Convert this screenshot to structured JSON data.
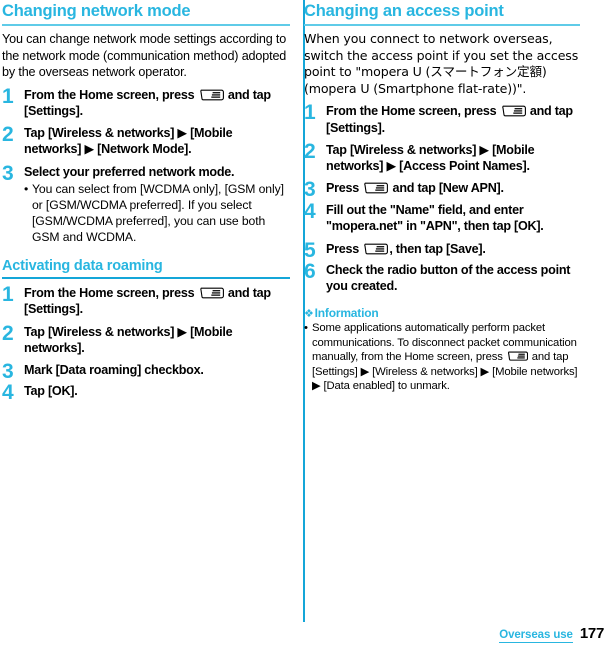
{
  "colors": {
    "accent": "#29b6e0",
    "accent_dark": "#14a6d8",
    "rule": "#5fcbe8",
    "text": "#000000"
  },
  "left_column": {
    "heading": "Changing network mode",
    "lead": "You can change network mode settings according to the network mode (communication method) adopted by the overseas network operator.",
    "steps": [
      {
        "number": "1",
        "text_before_icon": "From the Home screen, press ",
        "icon": "menu-key-icon",
        "text_after_icon": " and tap [Settings]."
      },
      {
        "number": "2",
        "text": "Tap [Wireless & networks] ▶ [Mobile networks] ▶ [Network Mode]."
      },
      {
        "number": "3",
        "text": "Select your preferred network mode.",
        "note_bullet": "•",
        "note": "You can select from [WCDMA only], [GSM only] or [GSM/WCDMA preferred]. If you select [GSM/WCDMA preferred], you can use both GSM and WCDMA."
      }
    ],
    "subheading": "Activating data roaming",
    "sub_steps": [
      {
        "number": "1",
        "text_before_icon": "From the Home screen, press ",
        "icon": "menu-key-icon",
        "text_after_icon": " and tap [Settings]."
      },
      {
        "number": "2",
        "text": "Tap [Wireless & networks] ▶ [Mobile networks]."
      },
      {
        "number": "3",
        "text": "Mark [Data roaming] checkbox."
      },
      {
        "number": "4",
        "text": "Tap [OK]."
      }
    ]
  },
  "right_column": {
    "heading": "Changing an access point",
    "lead": "When you connect to network overseas, switch the access point if you set the access point to \"mopera U (スマートフォン定額) (mopera U (Smartphone flat-rate))\".",
    "steps": [
      {
        "number": "1",
        "text_before_icon": "From the Home screen, press ",
        "icon": "menu-key-icon",
        "text_after_icon": " and tap [Settings]."
      },
      {
        "number": "2",
        "text": "Tap [Wireless & networks] ▶ [Mobile networks] ▶ [Access Point Names]."
      },
      {
        "number": "3",
        "text_before_icon": "Press ",
        "icon": "menu-key-icon",
        "text_after_icon": " and tap [New APN]."
      },
      {
        "number": "4",
        "text": "Fill out the \"Name\" field, and enter \"mopera.net\" in \"APN\", then tap [OK]."
      },
      {
        "number": "5",
        "text_before_icon": "Press ",
        "icon": "menu-key-icon",
        "text_after_icon": ", then tap [Save]."
      },
      {
        "number": "6",
        "text": "Check the radio button of the access point you created."
      }
    ],
    "information": {
      "floret": "❖",
      "title": "Information",
      "bullet": "•",
      "text_before_icon": "Some applications automatically perform packet communications. To disconnect packet communication manually, from the Home screen, press ",
      "icon": "menu-key-icon",
      "text_after_icon": " and tap [Settings] ▶ [Wireless & networks] ▶ [Mobile networks] ▶ [Data enabled] to unmark."
    }
  },
  "footer": {
    "section_label": "Overseas use",
    "page_number": "177"
  }
}
